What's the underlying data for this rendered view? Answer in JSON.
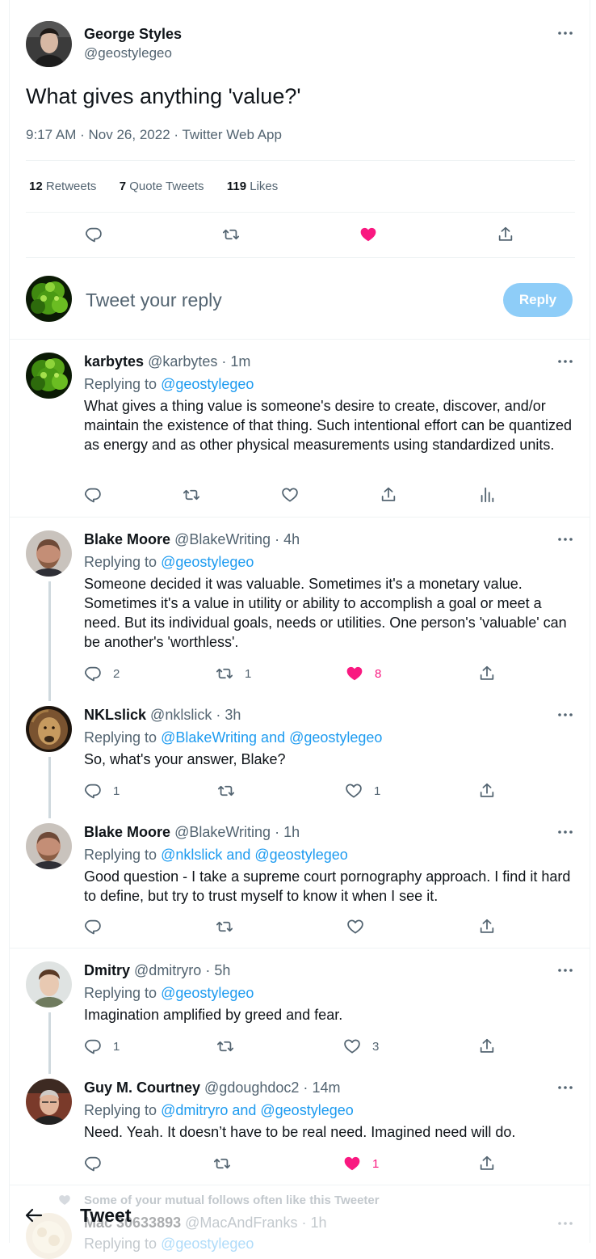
{
  "main_tweet": {
    "name": "George Styles",
    "handle": "@geostylegeo",
    "text": "What gives anything 'value?'",
    "time": "9:17 AM",
    "date": "Nov 26, 2022",
    "source": "Twitter Web App",
    "sep": "·",
    "stats": {
      "retweets_count": "12",
      "retweets_label": "Retweets",
      "quotes_count": "7",
      "quotes_label": "Quote Tweets",
      "likes_count": "119",
      "likes_label": "Likes"
    }
  },
  "reply_box": {
    "placeholder": "Tweet your reply",
    "button": "Reply"
  },
  "replying_to_label": "Replying to",
  "replies": [
    {
      "name": "karbytes",
      "handle": "@karbytes",
      "time": "1m",
      "replying_to": "@geostylegeo",
      "text": "What gives a thing value is someone's desire to create, discover, and/or maintain the existence of that thing. Such  intentional effort can be quantized as energy and as other physical measurements using standardized units."
    },
    {
      "name": "Blake Moore",
      "handle": "@BlakeWriting",
      "time": "4h",
      "replying_to": "@geostylegeo",
      "text": "Someone decided it was valuable. Sometimes it's a monetary value. Sometimes it's a value in utility or ability to accomplish a goal or meet a need. But its individual goals, needs or utilities. One person's 'valuable' can be another's 'worthless'.",
      "replies_count": "2",
      "retweets_count": "1",
      "likes_count": "8"
    },
    {
      "name": "NKLslick",
      "handle": "@nklslick",
      "time": "3h",
      "replying_to": "@BlakeWriting and @geostylegeo",
      "text": "So, what's your answer, Blake?",
      "replies_count": "1",
      "likes_count": "1"
    },
    {
      "name": "Blake Moore",
      "handle": "@BlakeWriting",
      "time": "1h",
      "replying_to": "@nklslick and @geostylegeo",
      "text": "Good question - I take a supreme court pornography approach. I find it hard to define, but try to trust myself to know it when I see it."
    },
    {
      "name": "Dmitry",
      "handle": "@dmitryro",
      "time": "5h",
      "replying_to": "@geostylegeo",
      "text": "Imagination amplified by greed and fear.",
      "replies_count": "1",
      "likes_count": "3"
    },
    {
      "name": "Guy M. Courtney",
      "handle": "@gdoughdoc2",
      "time": "14m",
      "replying_to": "@dmitryro and @geostylegeo",
      "text": "Need. Yeah. It doesn’t have to be real need. Imagined need will do.",
      "likes_count": "1"
    }
  ],
  "social_context": "Some of your mutual follows often like this Tweeter",
  "partial_reply": {
    "name": "Mac 30633893",
    "handle": "@MacAndFranks",
    "time": "1h",
    "replying_to_label": "Replying to",
    "replying_to": "@geostylegeo"
  },
  "header": {
    "title": "Tweet"
  },
  "colors": {
    "accent": "#1d9bf0",
    "like": "#f91880",
    "muted": "#536471",
    "text": "#0f1419",
    "reply_button_bg": "#8ecdf8"
  }
}
